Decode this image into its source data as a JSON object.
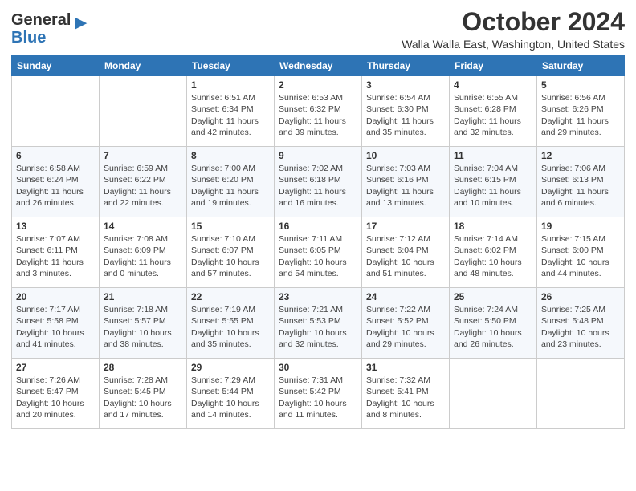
{
  "logo": {
    "general": "General",
    "blue": "Blue"
  },
  "title": "October 2024",
  "location": "Walla Walla East, Washington, United States",
  "days_of_week": [
    "Sunday",
    "Monday",
    "Tuesday",
    "Wednesday",
    "Thursday",
    "Friday",
    "Saturday"
  ],
  "weeks": [
    [
      {
        "day": "",
        "info": ""
      },
      {
        "day": "",
        "info": ""
      },
      {
        "day": "1",
        "info": "Sunrise: 6:51 AM\nSunset: 6:34 PM\nDaylight: 11 hours and 42 minutes."
      },
      {
        "day": "2",
        "info": "Sunrise: 6:53 AM\nSunset: 6:32 PM\nDaylight: 11 hours and 39 minutes."
      },
      {
        "day": "3",
        "info": "Sunrise: 6:54 AM\nSunset: 6:30 PM\nDaylight: 11 hours and 35 minutes."
      },
      {
        "day": "4",
        "info": "Sunrise: 6:55 AM\nSunset: 6:28 PM\nDaylight: 11 hours and 32 minutes."
      },
      {
        "day": "5",
        "info": "Sunrise: 6:56 AM\nSunset: 6:26 PM\nDaylight: 11 hours and 29 minutes."
      }
    ],
    [
      {
        "day": "6",
        "info": "Sunrise: 6:58 AM\nSunset: 6:24 PM\nDaylight: 11 hours and 26 minutes."
      },
      {
        "day": "7",
        "info": "Sunrise: 6:59 AM\nSunset: 6:22 PM\nDaylight: 11 hours and 22 minutes."
      },
      {
        "day": "8",
        "info": "Sunrise: 7:00 AM\nSunset: 6:20 PM\nDaylight: 11 hours and 19 minutes."
      },
      {
        "day": "9",
        "info": "Sunrise: 7:02 AM\nSunset: 6:18 PM\nDaylight: 11 hours and 16 minutes."
      },
      {
        "day": "10",
        "info": "Sunrise: 7:03 AM\nSunset: 6:16 PM\nDaylight: 11 hours and 13 minutes."
      },
      {
        "day": "11",
        "info": "Sunrise: 7:04 AM\nSunset: 6:15 PM\nDaylight: 11 hours and 10 minutes."
      },
      {
        "day": "12",
        "info": "Sunrise: 7:06 AM\nSunset: 6:13 PM\nDaylight: 11 hours and 6 minutes."
      }
    ],
    [
      {
        "day": "13",
        "info": "Sunrise: 7:07 AM\nSunset: 6:11 PM\nDaylight: 11 hours and 3 minutes."
      },
      {
        "day": "14",
        "info": "Sunrise: 7:08 AM\nSunset: 6:09 PM\nDaylight: 11 hours and 0 minutes."
      },
      {
        "day": "15",
        "info": "Sunrise: 7:10 AM\nSunset: 6:07 PM\nDaylight: 10 hours and 57 minutes."
      },
      {
        "day": "16",
        "info": "Sunrise: 7:11 AM\nSunset: 6:05 PM\nDaylight: 10 hours and 54 minutes."
      },
      {
        "day": "17",
        "info": "Sunrise: 7:12 AM\nSunset: 6:04 PM\nDaylight: 10 hours and 51 minutes."
      },
      {
        "day": "18",
        "info": "Sunrise: 7:14 AM\nSunset: 6:02 PM\nDaylight: 10 hours and 48 minutes."
      },
      {
        "day": "19",
        "info": "Sunrise: 7:15 AM\nSunset: 6:00 PM\nDaylight: 10 hours and 44 minutes."
      }
    ],
    [
      {
        "day": "20",
        "info": "Sunrise: 7:17 AM\nSunset: 5:58 PM\nDaylight: 10 hours and 41 minutes."
      },
      {
        "day": "21",
        "info": "Sunrise: 7:18 AM\nSunset: 5:57 PM\nDaylight: 10 hours and 38 minutes."
      },
      {
        "day": "22",
        "info": "Sunrise: 7:19 AM\nSunset: 5:55 PM\nDaylight: 10 hours and 35 minutes."
      },
      {
        "day": "23",
        "info": "Sunrise: 7:21 AM\nSunset: 5:53 PM\nDaylight: 10 hours and 32 minutes."
      },
      {
        "day": "24",
        "info": "Sunrise: 7:22 AM\nSunset: 5:52 PM\nDaylight: 10 hours and 29 minutes."
      },
      {
        "day": "25",
        "info": "Sunrise: 7:24 AM\nSunset: 5:50 PM\nDaylight: 10 hours and 26 minutes."
      },
      {
        "day": "26",
        "info": "Sunrise: 7:25 AM\nSunset: 5:48 PM\nDaylight: 10 hours and 23 minutes."
      }
    ],
    [
      {
        "day": "27",
        "info": "Sunrise: 7:26 AM\nSunset: 5:47 PM\nDaylight: 10 hours and 20 minutes."
      },
      {
        "day": "28",
        "info": "Sunrise: 7:28 AM\nSunset: 5:45 PM\nDaylight: 10 hours and 17 minutes."
      },
      {
        "day": "29",
        "info": "Sunrise: 7:29 AM\nSunset: 5:44 PM\nDaylight: 10 hours and 14 minutes."
      },
      {
        "day": "30",
        "info": "Sunrise: 7:31 AM\nSunset: 5:42 PM\nDaylight: 10 hours and 11 minutes."
      },
      {
        "day": "31",
        "info": "Sunrise: 7:32 AM\nSunset: 5:41 PM\nDaylight: 10 hours and 8 minutes."
      },
      {
        "day": "",
        "info": ""
      },
      {
        "day": "",
        "info": ""
      }
    ]
  ]
}
